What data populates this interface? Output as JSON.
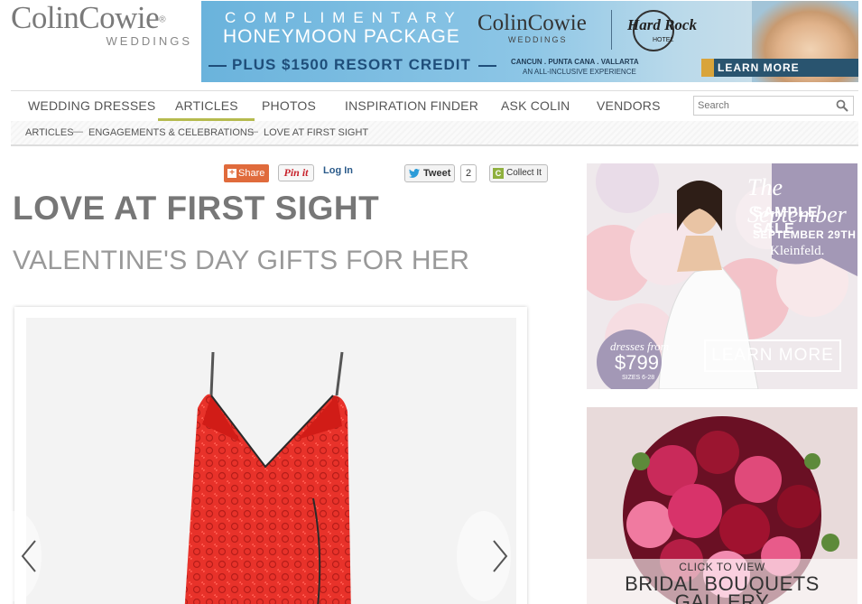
{
  "logo": {
    "main": "ColinCowie",
    "reg": "®",
    "sub": "WEDDINGS"
  },
  "banner": {
    "line1": "COMPLIMENTARY",
    "line2": "HONEYMOON PACKAGE",
    "line3": "PLUS $1500 RESORT CREDIT",
    "brand": "ColinCowie",
    "brand_sub": "WEDDINGS",
    "partner": "Hard Rock",
    "partner_sub": "HOTEL",
    "locations": "CANCUN . PUNTA CANA . VALLARTA",
    "tagline": "AN ALL-INCLUSIVE EXPERIENCE",
    "cta": "LEARN MORE"
  },
  "nav": {
    "items": [
      "WEDDING DRESSES",
      "ARTICLES",
      "PHOTOS",
      "INSPIRATION FINDER",
      "ASK COLIN",
      "VENDORS"
    ],
    "active": "ARTICLES",
    "search_placeholder": "Search"
  },
  "breadcrumb": {
    "items": [
      "ARTICLES",
      "ENGAGEMENTS & CELEBRATIONS",
      "LOVE AT FIRST SIGHT"
    ],
    "separator": "—"
  },
  "share": {
    "share_label": "Share",
    "pin_label": "Pin it",
    "login_label": "Log In",
    "tweet_label": "Tweet",
    "tweet_count": "2",
    "collect_label": "Collect It",
    "collect_icon": "C"
  },
  "article": {
    "title": "LOVE AT FIRST SIGHT",
    "subtitle": "VALENTINE'S DAY GIFTS FOR HER"
  },
  "ad_sale": {
    "line1": "The September",
    "line2": "SAMPLE SALE",
    "line3": "SEPTEMBER 29TH",
    "brand": "Kleinfeld.",
    "price_pre": "dresses from",
    "price": "$799",
    "sizes": "SIZES 6-28",
    "cta": "LEARN MORE"
  },
  "ad_bouquet": {
    "line1": "CLICK TO VIEW",
    "line2": "BRIDAL BOUQUETS",
    "line3": "GALLERY"
  },
  "colors": {
    "nav_active_underline": "#b5ba4e",
    "share_orange": "#e06b3c",
    "pin_red": "#c8232c",
    "banner_navy": "#29546f"
  }
}
